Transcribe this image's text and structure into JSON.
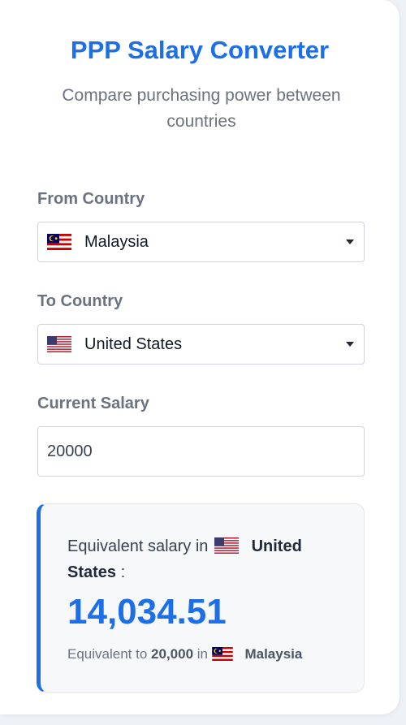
{
  "header": {
    "title": "PPP Salary Converter",
    "subtitle": "Compare purchasing power between countries"
  },
  "from": {
    "label": "From Country",
    "selected": "Malaysia",
    "flag_icon": "malaysia-flag-icon"
  },
  "to": {
    "label": "To Country",
    "selected": "United States",
    "flag_icon": "us-flag-icon"
  },
  "salary": {
    "label": "Current Salary",
    "value": "20000"
  },
  "result": {
    "prefix": "Equivalent salary in",
    "country": "United States",
    "suffix": ":",
    "amount": "14,034.51",
    "note_prefix": "Equivalent to",
    "note_amount": "20,000",
    "note_in": "in",
    "note_country": "Malaysia"
  },
  "colors": {
    "accent": "#1d6fe8",
    "muted_text": "#6b7280",
    "result_bg": "#f7f8fa"
  }
}
